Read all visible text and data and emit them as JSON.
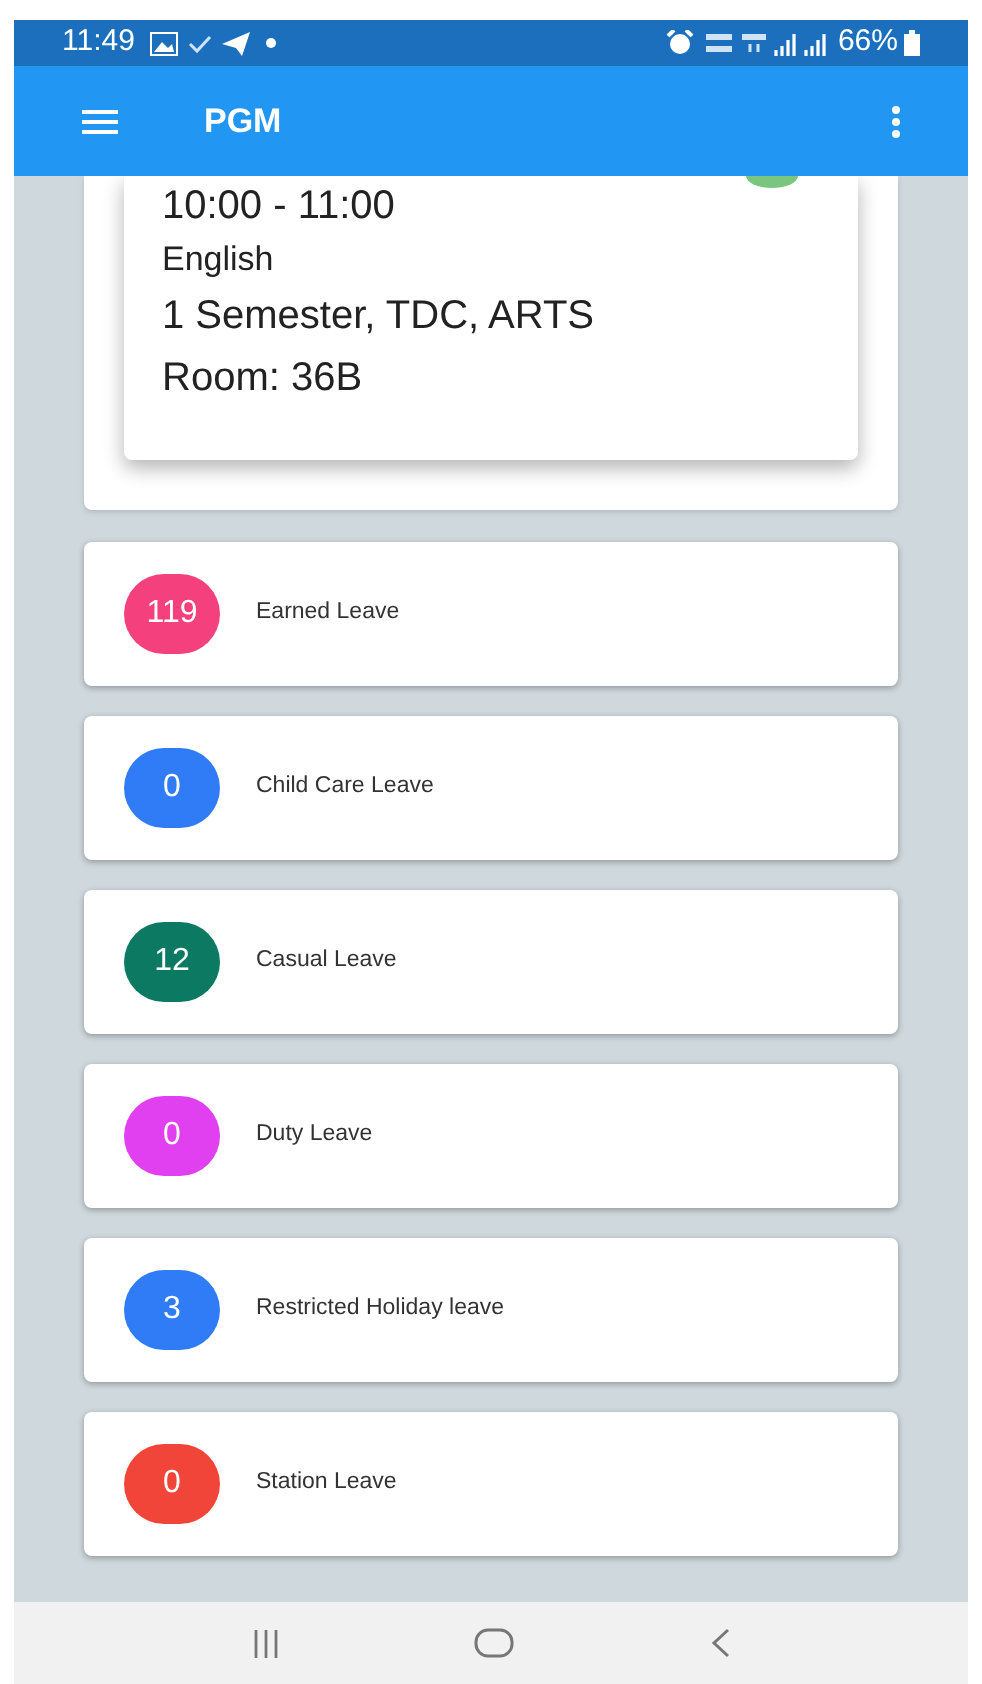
{
  "status_bar": {
    "time": "11:49",
    "battery": "66%"
  },
  "app_bar": {
    "title": "PGM"
  },
  "class_card": {
    "time": "10:00 - 11:00",
    "subject": "English",
    "course": "1 Semester, TDC, ARTS",
    "room": "Room: 36B"
  },
  "leaves": [
    {
      "count": "119",
      "label": "Earned Leave",
      "color": "#f5407e"
    },
    {
      "count": "0",
      "label": "Child Care Leave",
      "color": "#2f7cf6"
    },
    {
      "count": "12",
      "label": "Casual Leave",
      "color": "#0c7a62"
    },
    {
      "count": "0",
      "label": "Duty Leave",
      "color": "#e040f0"
    },
    {
      "count": "3",
      "label": "Restricted Holiday leave",
      "color": "#2f7cf6"
    },
    {
      "count": "0",
      "label": "Station Leave",
      "color": "#f2453a"
    }
  ]
}
